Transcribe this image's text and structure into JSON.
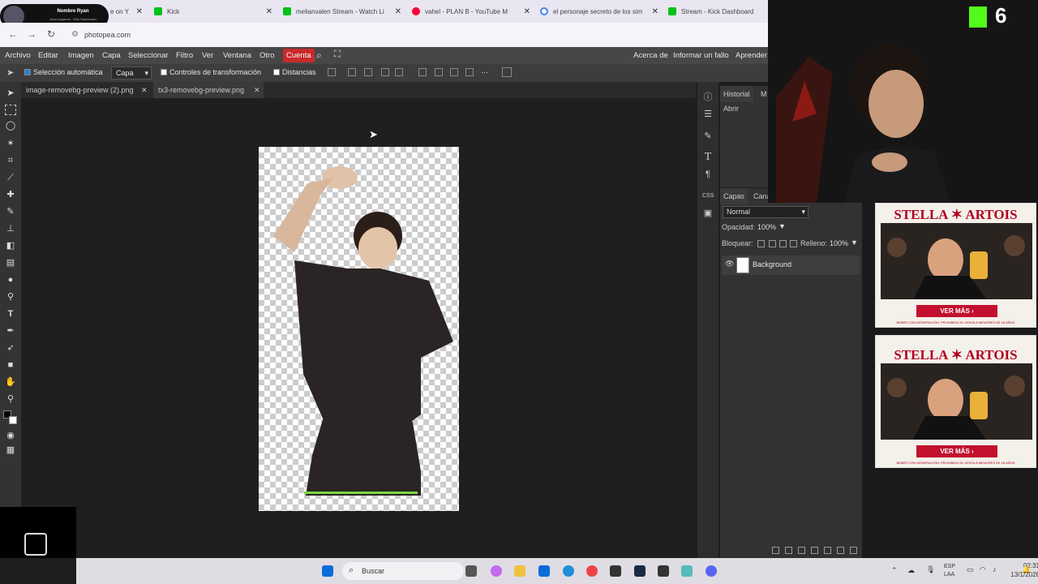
{
  "browser": {
    "tabs": [
      {
        "label": "e on Y",
        "color": "#555555"
      },
      {
        "label": "Kick",
        "color": "#00c21a"
      },
      {
        "label": "melianvalen Stream - Watch Li",
        "color": "#00c21a"
      },
      {
        "label": "vahel - PLAN B - YouTube M",
        "color": "#ff0033"
      },
      {
        "label": "el personaje secreto de los sim",
        "color": "#4285f4"
      },
      {
        "label": "Stream - Kick Dashboard",
        "color": "#00c21a"
      }
    ],
    "url": "photopea.com"
  },
  "photopea": {
    "menu": [
      "Archivo",
      "Editar",
      "Imagen",
      "Capa",
      "Seleccionar",
      "Filtro",
      "Ver",
      "Ventana",
      "Otro"
    ],
    "account": "Cuenta",
    "menu_right": [
      "Acerca de",
      "Informar un fallo",
      "Aprender"
    ],
    "options": {
      "auto_select": "Selección automática",
      "auto_select_target": "Capa",
      "transform_controls": "Controles de transformación",
      "distances": "Distancias"
    },
    "doc_tabs": [
      "image-removebg-preview (2).png",
      "tx3-removebg-preview.png"
    ],
    "panels": {
      "history_tab": "Historial",
      "history_tab2": "M",
      "history_item": "Abrir",
      "layers_tab": "Capas",
      "channels_tab": "Cana",
      "blend_mode": "Normal",
      "opacity_label": "Opacidad:",
      "opacity": "100%",
      "lock_label": "Bloquear:",
      "fill_label": "Relleno:",
      "fill": "100%",
      "layer_name": "Background"
    },
    "side_icons": [
      "CSS"
    ]
  },
  "stream": {
    "kick_count": "6",
    "overlay_title": "Nombre Ryan",
    "overlay_sub": "ahora jugando - Kick Dashboard"
  },
  "ads": [
    {
      "brand": "STELLA ✶ ARTOIS",
      "cta": "VER MÁS ›",
      "fine": "BEBER CON MODERACIÓN. PROHIBIDA SU VENTA A MENORES DE 18 AÑOS"
    },
    {
      "brand": "STELLA ✶ ARTOIS",
      "cta": "VER MÁS ›",
      "fine": "BEBER CON MODERACIÓN. PROHIBIDA SU VENTA A MENORES DE 18 AÑOS"
    }
  ],
  "taskbar": {
    "search": "Buscar",
    "lang1": "ESP",
    "lang2": "LAA",
    "time": "02:31",
    "date": "13/1/2026"
  }
}
